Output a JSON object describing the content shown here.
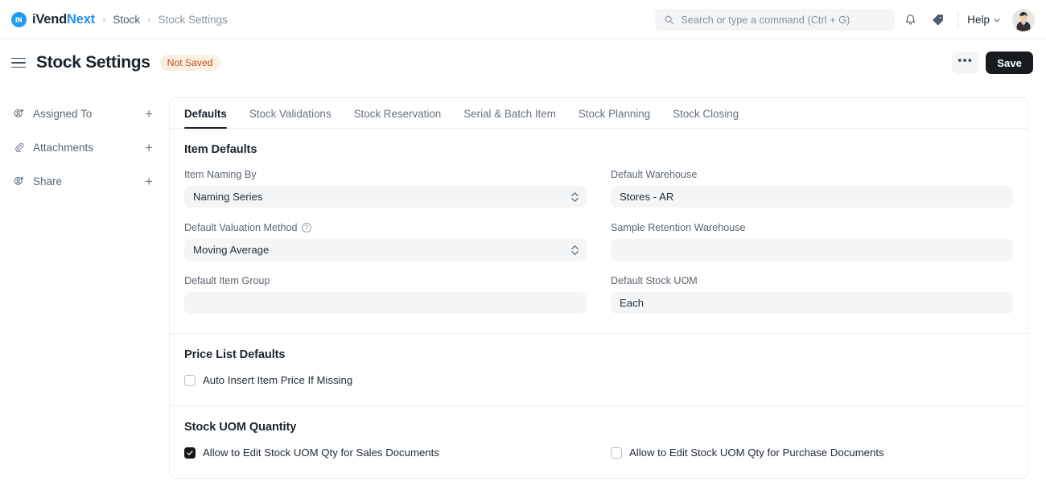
{
  "navbar": {
    "brand": {
      "part1": "iVend",
      "part2": "Next",
      "logo_icon": "ivend-logo-icon",
      "logo_color": "#1f9cf0"
    },
    "breadcrumbs": [
      {
        "label": "Stock",
        "muted": false
      },
      {
        "label": "Stock Settings",
        "muted": true
      }
    ],
    "separator": "›",
    "search": {
      "placeholder": "Search or type a command (Ctrl + G)",
      "icon": "search-icon"
    },
    "notifications_icon": "bell-icon",
    "tag_icon": "tag-icon",
    "help": {
      "label": "Help",
      "chevron": "chevron-down-icon"
    },
    "avatar": "user-avatar"
  },
  "header": {
    "menu_icon": "hamburger-icon",
    "title": "Stock Settings",
    "status_badge": {
      "label": "Not Saved",
      "bg": "#fdeee2",
      "color": "#b4541a"
    },
    "more_button": "•••",
    "save_label": "Save"
  },
  "sidebar": {
    "items": [
      {
        "label": "Assigned To",
        "icon": "user-plus-icon",
        "action": "+"
      },
      {
        "label": "Attachments",
        "icon": "paperclip-icon",
        "action": "+"
      },
      {
        "label": "Share",
        "icon": "user-plus-icon",
        "action": "+"
      }
    ]
  },
  "tabs": [
    {
      "label": "Defaults",
      "active": true
    },
    {
      "label": "Stock Validations",
      "active": false
    },
    {
      "label": "Stock Reservation",
      "active": false
    },
    {
      "label": "Serial & Batch Item",
      "active": false
    },
    {
      "label": "Stock Planning",
      "active": false
    },
    {
      "label": "Stock Closing",
      "active": false
    }
  ],
  "sections": {
    "item_defaults": {
      "title": "Item Defaults",
      "fields": {
        "item_naming_by": {
          "label": "Item Naming By",
          "value": "Naming Series",
          "type": "select"
        },
        "default_warehouse": {
          "label": "Default Warehouse",
          "value": "Stores - AR",
          "type": "link"
        },
        "default_valuation_method": {
          "label": "Default Valuation Method",
          "value": "Moving Average",
          "type": "select",
          "help": "?"
        },
        "sample_retention_warehouse": {
          "label": "Sample Retention Warehouse",
          "value": "",
          "type": "link"
        },
        "default_item_group": {
          "label": "Default Item Group",
          "value": "",
          "type": "link"
        },
        "default_stock_uom": {
          "label": "Default Stock UOM",
          "value": "Each",
          "type": "link"
        }
      }
    },
    "price_list_defaults": {
      "title": "Price List Defaults",
      "checkbox": {
        "label": "Auto Insert Item Price If Missing",
        "checked": false
      }
    },
    "stock_uom_quantity": {
      "title": "Stock UOM Quantity",
      "checkbox_left": {
        "label": "Allow to Edit Stock UOM Qty for Sales Documents",
        "checked": true
      },
      "checkbox_right": {
        "label": "Allow to Edit Stock UOM Qty for Purchase Documents",
        "checked": false
      }
    }
  }
}
